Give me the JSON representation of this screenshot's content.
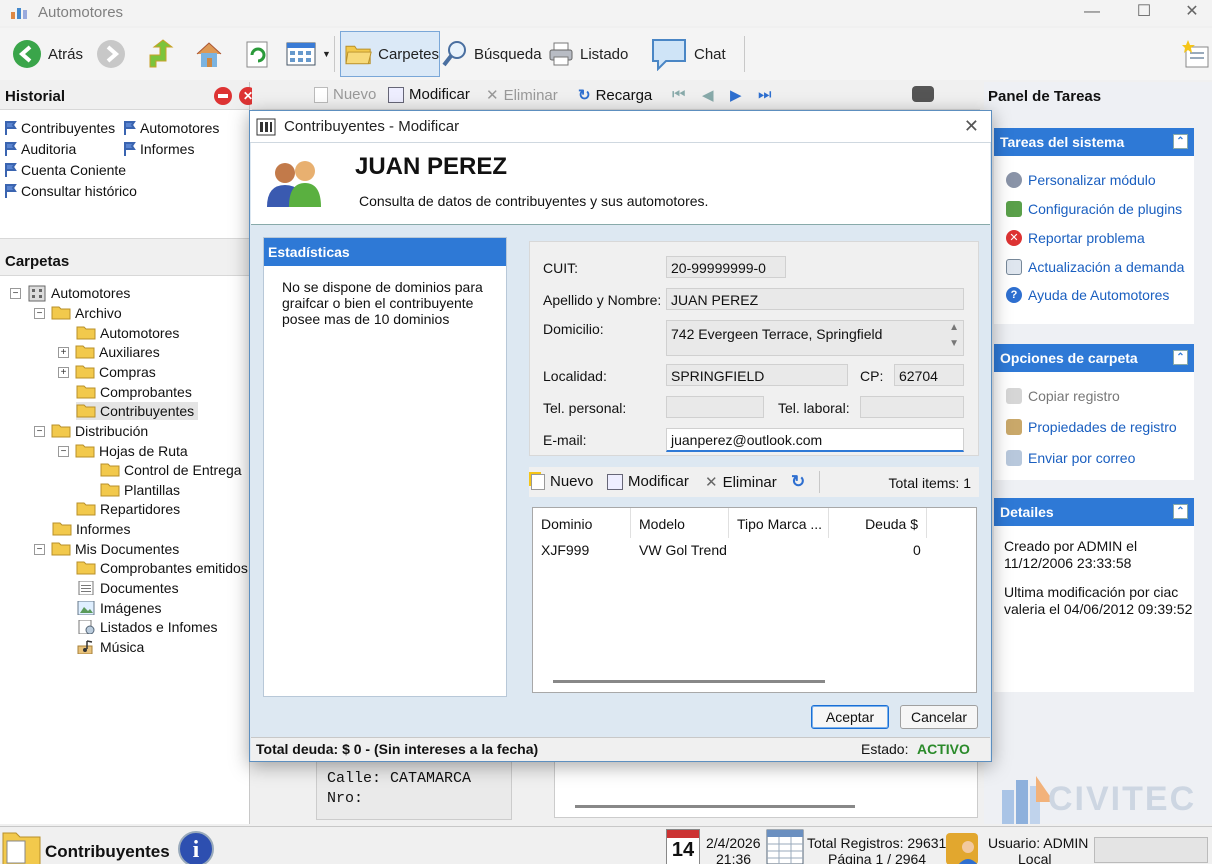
{
  "window": {
    "title": "Automotores"
  },
  "toolbar": {
    "back": "Atrás",
    "carpetas": "Carpetes",
    "busqueda": "Búsqueda",
    "listado": "Listado",
    "chat": "Chat"
  },
  "historial": {
    "title": "Historial",
    "items": [
      "Contribuyentes",
      "Automotores",
      "Auditoria",
      "Informes",
      "Cuenta Coniente",
      "Consultar histórico"
    ]
  },
  "carpetas": {
    "title": "Carpetas",
    "tree": [
      "Automotores",
      "Archivo",
      "Automotores",
      "Auxiliares",
      "Compras",
      "Comprobantes",
      "Contribuyentes",
      "Distribución",
      "Hojas de Ruta",
      "Control de Entrega",
      "Plantillas",
      "Repartidores",
      "Informes",
      "Mis Documentes",
      "Comprobantes emitidos",
      "Documentes",
      "Imágenes",
      "Listados e Infomes",
      "Música"
    ]
  },
  "center_toolbar": {
    "nuevo": "Nuevo",
    "modificar": "Modificar",
    "eliminar": "Eliminar",
    "recarga": "Recarga"
  },
  "task_pane": {
    "title": "Panel de Tareas",
    "system": {
      "title": "Tareas del sistema",
      "items": [
        "Personalizar módulo",
        "Configuración de plugins",
        "Reportar problema",
        "Actualización a demanda",
        "Ayuda de Automotores"
      ]
    },
    "folder": {
      "title": "Opciones de carpeta",
      "items": [
        "Copiar registro",
        "Propiedades de registro",
        "Enviar por correo"
      ]
    },
    "details": {
      "title": "Detailes",
      "created": "Creado por ADMIN el 11/12/2006 23:33:58",
      "modified": "Ultima modificación por ciac valeria el 04/06/2012 09:39:52"
    }
  },
  "background": {
    "line1": "Calle: CATAMARCA",
    "line2": "Nro:"
  },
  "status": {
    "module": "Contribuyentes",
    "cal_day": "14",
    "date": "2/4/2026",
    "time": "21:36",
    "total": "Total Registros: 29631",
    "page": "Página 1 / 2964",
    "user": "Usuario: ADMIN",
    "user_loc": "Local"
  },
  "branding": {
    "logo_text": "CIVITEC"
  },
  "dialog": {
    "title": "Contribuyentes - Modificar",
    "name": "JUAN PEREZ",
    "subtitle": "Consulta de datos de contribuyentes y sus automotores.",
    "stats_title": "Estadísticas",
    "stats_text": "No se dispone de dominios para graifcar o bien el contribuyente posee mas de 10 dominios",
    "labels": {
      "cuit": "CUIT:",
      "name": "Apellido y Nombre:",
      "domicilio": "Domicilio:",
      "localidad": "Localidad:",
      "cp": "CP:",
      "tel_personal": "Tel. personal:",
      "tel_laboral": "Tel. laboral:",
      "email": "E-mail:"
    },
    "values": {
      "cuit": "20-99999999-0",
      "name": "JUAN PEREZ",
      "domicilio": "742 Evergeen Terrace, Springfield",
      "localidad": "SPRINGFIELD",
      "cp": "62704",
      "tel_personal": "",
      "tel_laboral": "",
      "email": "juanperez@outlook.com"
    },
    "sub_toolbar": {
      "nuevo": "Nuevo",
      "modificar": "Modificar",
      "eliminar": "Eliminar",
      "total": "Total items: 1"
    },
    "grid": {
      "columns": [
        "Dominio",
        "Modelo",
        "Tipo Marca ...",
        "Deuda $"
      ],
      "rows": [
        [
          "XJF999",
          "VW Gol Trend",
          "",
          "0"
        ]
      ]
    },
    "accept": "Aceptar",
    "cancel": "Cancelar",
    "footer_debt": "Total deuda: $ 0 - (Sin intereses a la fecha)",
    "footer_state_label": "Estado:",
    "footer_state": "ACTIVO"
  }
}
